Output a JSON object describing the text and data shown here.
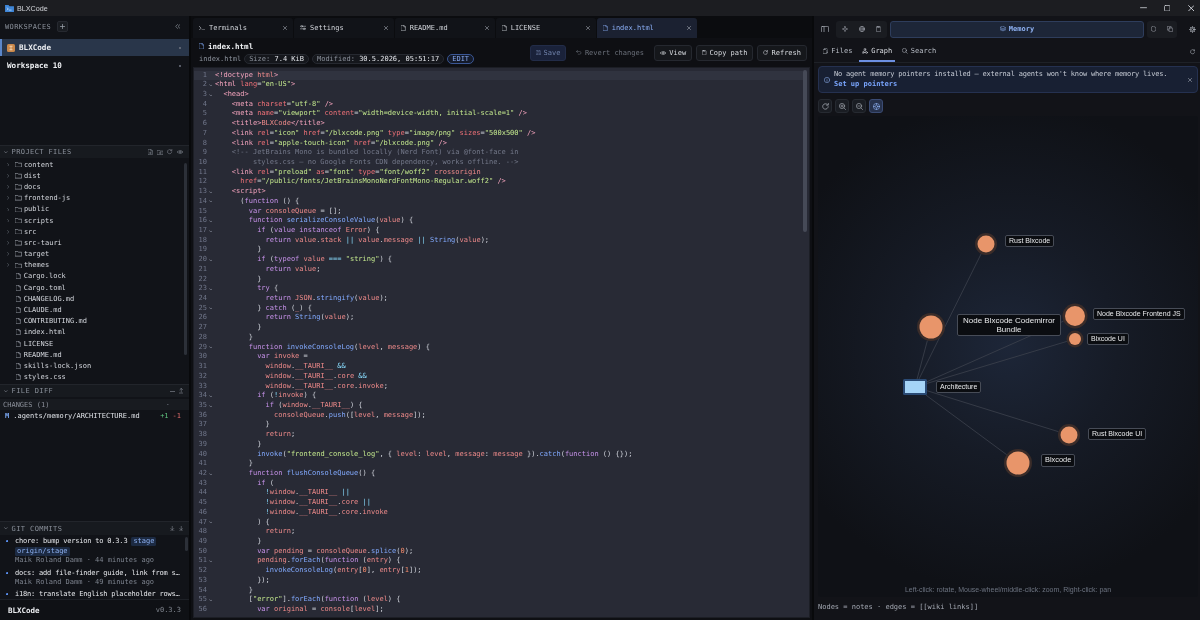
{
  "window": {
    "title": "BLXCode"
  },
  "sidebar": {
    "workspaces": {
      "title": "WORKSPACES",
      "items": [
        {
          "name": "BLXCode",
          "selected": true,
          "logo": true
        },
        {
          "name": "Workspace 10",
          "selected": false,
          "logo": false
        }
      ]
    },
    "project_files": {
      "title": "PROJECT FILES",
      "items": [
        {
          "name": "content",
          "kind": "folder"
        },
        {
          "name": "dist",
          "kind": "folder"
        },
        {
          "name": "docs",
          "kind": "folder"
        },
        {
          "name": "frontend-js",
          "kind": "folder"
        },
        {
          "name": "public",
          "kind": "folder"
        },
        {
          "name": "scripts",
          "kind": "folder"
        },
        {
          "name": "src",
          "kind": "folder"
        },
        {
          "name": "src-tauri",
          "kind": "folder"
        },
        {
          "name": "target",
          "kind": "folder"
        },
        {
          "name": "themes",
          "kind": "folder"
        },
        {
          "name": "Cargo.lock",
          "kind": "file"
        },
        {
          "name": "Cargo.toml",
          "kind": "file"
        },
        {
          "name": "CHANGELOG.md",
          "kind": "file"
        },
        {
          "name": "CLAUDE.md",
          "kind": "file"
        },
        {
          "name": "CONTRIBUTING.md",
          "kind": "file"
        },
        {
          "name": "index.html",
          "kind": "file"
        },
        {
          "name": "LICENSE",
          "kind": "file"
        },
        {
          "name": "README.md",
          "kind": "file"
        },
        {
          "name": "skills-lock.json",
          "kind": "file"
        },
        {
          "name": "styles.css",
          "kind": "file"
        }
      ]
    },
    "file_diff": {
      "title": "FILE DIFF",
      "changes_label": "CHANGES (1)",
      "changes": [
        {
          "status": "M",
          "path": ".agents/memory/ARCHITECTURE.md",
          "added": "+1",
          "removed": "-1"
        }
      ]
    },
    "git_commits": {
      "title": "GIT COMMITS",
      "commits": [
        {
          "message": "chore: bump version to 0.3.3",
          "tags": [
            "stage",
            "origin/stage"
          ],
          "byline": "Maik Roland Damm · 44 minutes ago"
        },
        {
          "message": "docs: add file-finder guide, link from s…",
          "byline": "Maik Roland Damm · 49 minutes ago"
        },
        {
          "message": "i18n: translate English placeholder rows…"
        }
      ]
    },
    "footer": {
      "app": "BLXCode",
      "version": "v0.3.3"
    }
  },
  "editor": {
    "tabs": [
      {
        "label": "Terminals",
        "kind": "terminal",
        "selected": false
      },
      {
        "label": "Settings",
        "kind": "settings",
        "selected": false
      },
      {
        "label": "README.md",
        "kind": "file",
        "selected": false
      },
      {
        "label": "LICENSE",
        "kind": "file",
        "selected": false
      },
      {
        "label": "index.html",
        "kind": "file",
        "selected": true
      }
    ],
    "file": {
      "title": "index.html",
      "name": "index.html",
      "size": "Size: **7.4 KiB**",
      "modified": "Modified: **30.5.2026, 05:51:17**",
      "mode": "EDIT"
    },
    "actions": [
      {
        "label": "Save",
        "primary": true,
        "disabled": true
      },
      {
        "label": "Revert changes",
        "primary": false,
        "disabled": true
      },
      {
        "label": "View",
        "primary": false,
        "disabled": false
      },
      {
        "label": "Copy path",
        "primary": false,
        "disabled": false
      },
      {
        "label": "Refresh",
        "primary": false,
        "disabled": false
      }
    ],
    "lines": [
      {
        "number": "1",
        "text": "<!doctype html>",
        "fold": false,
        "active": true
      },
      {
        "number": "2",
        "text": "<html lang=\"en-US\">",
        "fold": true,
        "active": false
      },
      {
        "number": "3",
        "text": "  <head>",
        "fold": true,
        "active": false
      },
      {
        "number": "4",
        "text": "    <meta charset=\"utf-8\" />",
        "fold": false,
        "active": false
      },
      {
        "number": "5",
        "text": "    <meta name=\"viewport\" content=\"width=device-width, initial-scale=1\" />",
        "fold": false,
        "active": false
      },
      {
        "number": "6",
        "text": "    <title>BLXCode</title>",
        "fold": false,
        "active": false
      },
      {
        "number": "7",
        "text": "    <link rel=\"icon\" href=\"/blxcode.png\" type=\"image/png\" sizes=\"500x500\" />",
        "fold": false,
        "active": false
      },
      {
        "number": "8",
        "text": "    <link rel=\"apple-touch-icon\" href=\"/blxcode.png\" />",
        "fold": false,
        "active": false
      },
      {
        "number": "9",
        "text": "    <!-- JetBrains Mono is bundled locally (Nerd Font) via @font-face in",
        "fold": false,
        "active": false
      },
      {
        "number": "10",
        "text": "         styles.css — no Google Fonts CDN dependency, works offline. -->",
        "fold": false,
        "active": false
      },
      {
        "number": "11",
        "text": "    <link rel=\"preload\" as=\"font\" type=\"font/woff2\" crossorigin",
        "fold": false,
        "active": false
      },
      {
        "number": "12",
        "text": "      href=\"/public/fonts/JetBrainsMonoNerdFontMono-Regular.woff2\" />",
        "fold": false,
        "active": false
      },
      {
        "number": "13",
        "text": "    <script>",
        "fold": true,
        "active": false
      },
      {
        "number": "14",
        "text": "      (function () {",
        "fold": true,
        "active": false
      },
      {
        "number": "15",
        "text": "        var consoleQueue = [];",
        "fold": false,
        "active": false
      },
      {
        "number": "16",
        "text": "        function serializeConsoleValue(value) {",
        "fold": true,
        "active": false
      },
      {
        "number": "17",
        "text": "          if (value instanceof Error) {",
        "fold": true,
        "active": false
      },
      {
        "number": "18",
        "text": "            return value.stack || value.message || String(value);",
        "fold": false,
        "active": false
      },
      {
        "number": "19",
        "text": "          }",
        "fold": false,
        "active": false
      },
      {
        "number": "20",
        "text": "          if (typeof value === \"string\") {",
        "fold": true,
        "active": false
      },
      {
        "number": "21",
        "text": "            return value;",
        "fold": false,
        "active": false
      },
      {
        "number": "22",
        "text": "          }",
        "fold": false,
        "active": false
      },
      {
        "number": "23",
        "text": "          try {",
        "fold": true,
        "active": false
      },
      {
        "number": "24",
        "text": "            return JSON.stringify(value);",
        "fold": false,
        "active": false
      },
      {
        "number": "25",
        "text": "          } catch (_) {",
        "fold": true,
        "active": false
      },
      {
        "number": "26",
        "text": "            return String(value);",
        "fold": false,
        "active": false
      },
      {
        "number": "27",
        "text": "          }",
        "fold": false,
        "active": false
      },
      {
        "number": "28",
        "text": "        }",
        "fold": false,
        "active": false
      },
      {
        "number": "29",
        "text": "        function invokeConsoleLog(level, message) {",
        "fold": true,
        "active": false
      },
      {
        "number": "30",
        "text": "          var invoke =",
        "fold": false,
        "active": false
      },
      {
        "number": "31",
        "text": "            window.__TAURI__ &&",
        "fold": false,
        "active": false
      },
      {
        "number": "32",
        "text": "            window.__TAURI__.core &&",
        "fold": false,
        "active": false
      },
      {
        "number": "33",
        "text": "            window.__TAURI__.core.invoke;",
        "fold": false,
        "active": false
      },
      {
        "number": "34",
        "text": "          if (!invoke) {",
        "fold": true,
        "active": false
      },
      {
        "number": "35",
        "text": "            if (window.__TAURI__) {",
        "fold": true,
        "active": false
      },
      {
        "number": "36",
        "text": "              consoleQueue.push([level, message]);",
        "fold": false,
        "active": false
      },
      {
        "number": "37",
        "text": "            }",
        "fold": false,
        "active": false
      },
      {
        "number": "38",
        "text": "            return;",
        "fold": false,
        "active": false
      },
      {
        "number": "39",
        "text": "          }",
        "fold": false,
        "active": false
      },
      {
        "number": "40",
        "text": "          invoke(\"frontend_console_log\", { level: level, message: message }).catch(function () {});",
        "fold": false,
        "active": false
      },
      {
        "number": "41",
        "text": "        }",
        "fold": false,
        "active": false
      },
      {
        "number": "42",
        "text": "        function flushConsoleQueue() {",
        "fold": true,
        "active": false
      },
      {
        "number": "43",
        "text": "          if (",
        "fold": false,
        "active": false
      },
      {
        "number": "44",
        "text": "            !window.__TAURI__ ||",
        "fold": false,
        "active": false
      },
      {
        "number": "45",
        "text": "            !window.__TAURI__.core ||",
        "fold": false,
        "active": false
      },
      {
        "number": "46",
        "text": "            !window.__TAURI__.core.invoke",
        "fold": false,
        "active": false
      },
      {
        "number": "47",
        "text": "          ) {",
        "fold": true,
        "active": false
      },
      {
        "number": "48",
        "text": "            return;",
        "fold": false,
        "active": false
      },
      {
        "number": "49",
        "text": "          }",
        "fold": false,
        "active": false
      },
      {
        "number": "50",
        "text": "          var pending = consoleQueue.splice(0);",
        "fold": false,
        "active": false
      },
      {
        "number": "51",
        "text": "          pending.forEach(function (entry) {",
        "fold": true,
        "active": false
      },
      {
        "number": "52",
        "text": "            invokeConsoleLog(entry[0], entry[1]);",
        "fold": false,
        "active": false
      },
      {
        "number": "53",
        "text": "          });",
        "fold": false,
        "active": false
      },
      {
        "number": "54",
        "text": "        }",
        "fold": false,
        "active": false
      },
      {
        "number": "55",
        "text": "        [\"error\"].forEach(function (level) {",
        "fold": true,
        "active": false
      },
      {
        "number": "56",
        "text": "          var original = console[level];",
        "fold": false,
        "active": false
      }
    ]
  },
  "memory_panel": {
    "toolbar": [
      {
        "label": "Memory",
        "selected": true
      }
    ],
    "tabs": [
      {
        "label": "Files",
        "selected": false
      },
      {
        "label": "Graph",
        "selected": true
      },
      {
        "label": "Search",
        "selected": false
      }
    ],
    "banner": {
      "message": "No agent memory pointers installed — external agents won't know where memory lives.",
      "link": "Set up pointers"
    },
    "graph_tools": [
      {
        "active": false
      },
      {
        "active": false
      },
      {
        "active": false
      },
      {
        "active": true
      }
    ],
    "graph": {
      "center": {
        "label": "Architecture"
      },
      "nodes": [
        {
          "label": "Rust Blxcode",
          "linked": true
        },
        {
          "label": "Node Blxcode Codemirror Bundle",
          "linked": true
        },
        {
          "label": "Node Blxcode Frontend JS",
          "linked": true
        },
        {
          "label": "Blxcode UI",
          "linked": true
        },
        {
          "label": "Rust Blxcode UI",
          "linked": true
        },
        {
          "label": "Blxcode",
          "linked": true
        }
      ],
      "hint": "Left-click: rotate, Mouse-wheel/middle-click: zoom, Right-click: pan"
    },
    "legend": "Nodes = notes · edges = [[wiki links]]"
  }
}
